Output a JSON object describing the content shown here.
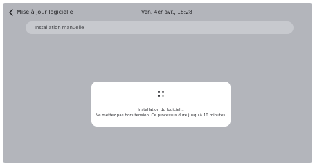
{
  "header": {
    "title": "Mise à jour logicielle",
    "datetime": "Ven. 4er avr., 18:28",
    "back_icon": "chevron-left-icon"
  },
  "list": {
    "manual_install_label": "Installation manuelle"
  },
  "dialog": {
    "spinner_icon": "loading-spinner-icon",
    "message_line1": "Installation du logiciel...",
    "message_line2": "Ne mettez pas hors tension. Ce processus dure jusqu'à 10 minutes."
  },
  "colors": {
    "screen_background": "#b3b5bb",
    "row_background": "#c7c9ce",
    "dialog_background": "#ffffff",
    "text_primary": "#1f1f22"
  }
}
